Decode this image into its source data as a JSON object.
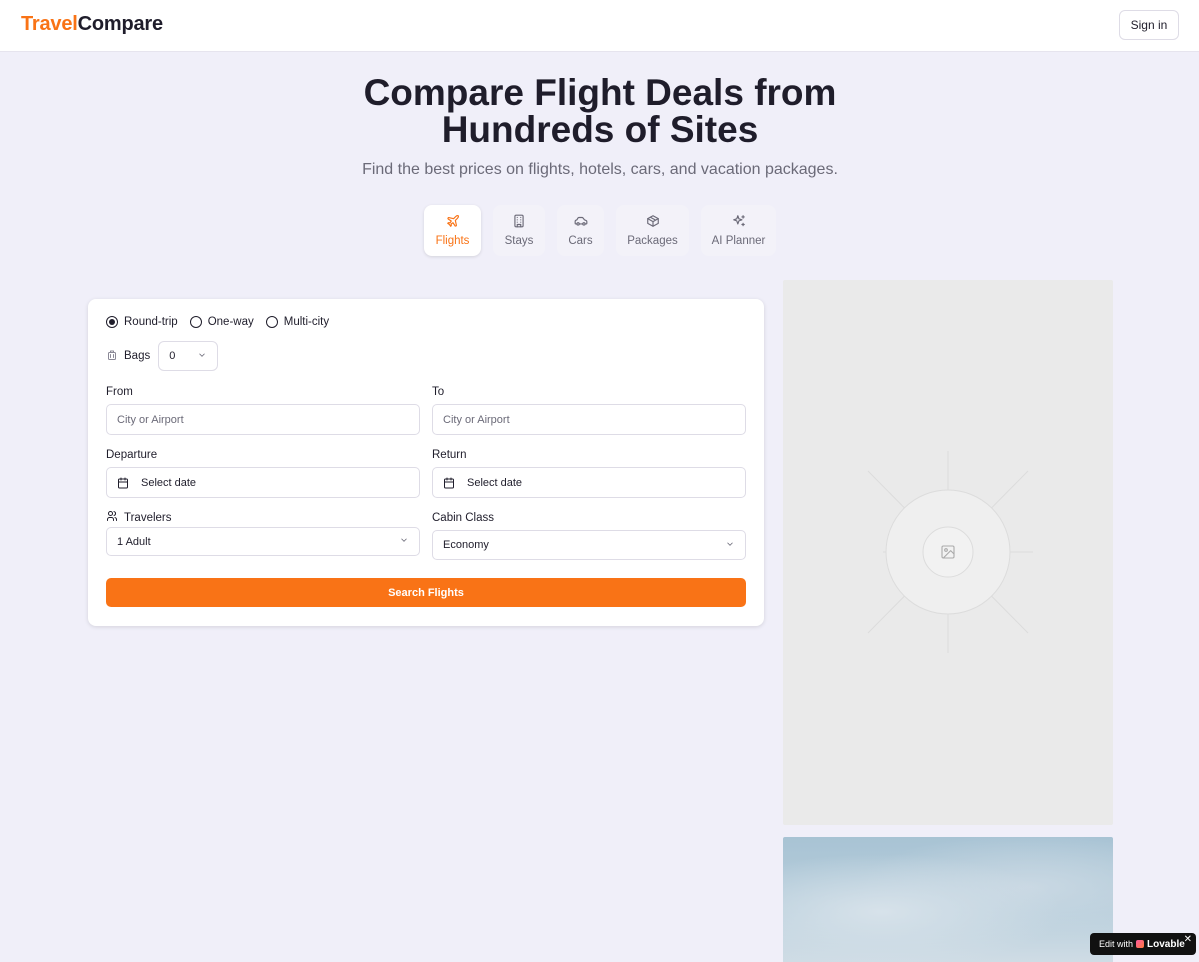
{
  "header": {
    "logo_part1": "Travel",
    "logo_part2": "Compare",
    "signin_label": "Sign in"
  },
  "hero": {
    "title_line1": "Compare Flight Deals from",
    "title_line2": "Hundreds of Sites",
    "subtitle": "Find the best prices on flights, hotels, cars, and vacation packages."
  },
  "tabs": [
    {
      "label": "Flights",
      "icon": "plane-icon",
      "active": true
    },
    {
      "label": "Stays",
      "icon": "building-icon",
      "active": false
    },
    {
      "label": "Cars",
      "icon": "car-icon",
      "active": false
    },
    {
      "label": "Packages",
      "icon": "package-icon",
      "active": false
    },
    {
      "label": "AI Planner",
      "icon": "sparkles-icon",
      "active": false
    }
  ],
  "form": {
    "trip_types": [
      {
        "label": "Round-trip",
        "selected": true
      },
      {
        "label": "One-way",
        "selected": false
      },
      {
        "label": "Multi-city",
        "selected": false
      }
    ],
    "bags_label": "Bags",
    "bags_value": "0",
    "from_label": "From",
    "from_placeholder": "City or Airport",
    "to_label": "To",
    "to_placeholder": "City or Airport",
    "departure_label": "Departure",
    "departure_value": "Select date",
    "return_label": "Return",
    "return_value": "Select date",
    "travelers_label": "Travelers",
    "travelers_value": "1 Adult",
    "cabin_label": "Cabin Class",
    "cabin_value": "Economy",
    "search_label": "Search Flights"
  },
  "badge": {
    "prefix": "Edit with",
    "brand": "Lovable",
    "close": "✕"
  },
  "colors": {
    "accent": "#f97316",
    "background": "#f0eff9"
  }
}
